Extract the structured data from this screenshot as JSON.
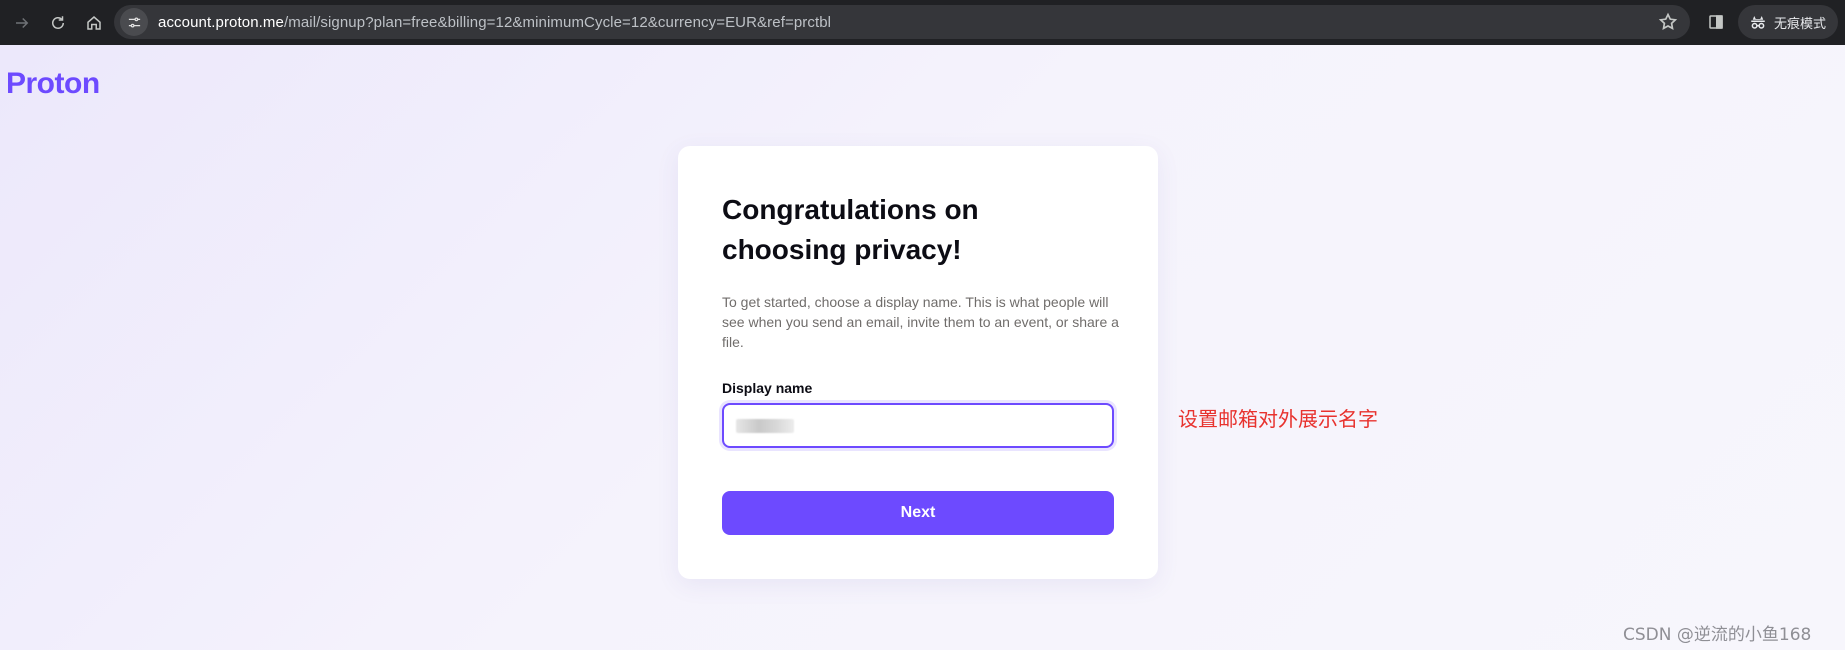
{
  "browser": {
    "url_host": "account.proton.me",
    "url_path": "/mail/signup?plan=free&billing=12&minimumCycle=12&currency=EUR&ref=prctbl",
    "incognito_label": "无痕模式",
    "icons": [
      "arrow-right-icon",
      "reload-icon",
      "home-icon",
      "site-settings-icon",
      "bookmark-star-icon",
      "side-panel-icon",
      "incognito-icon"
    ]
  },
  "page": {
    "logo": "Proton",
    "title": "Congratulations on choosing privacy!",
    "description": "To get started, choose a display name. This is what people will see when you send an email, invite them to an event, or share a file.",
    "display_name_label": "Display name",
    "display_name_value": "",
    "next_label": "Next",
    "accent_color": "#6d4aff"
  },
  "annotation": "设置邮箱对外展示名字",
  "watermark": "CSDN @逆流的小鱼168"
}
